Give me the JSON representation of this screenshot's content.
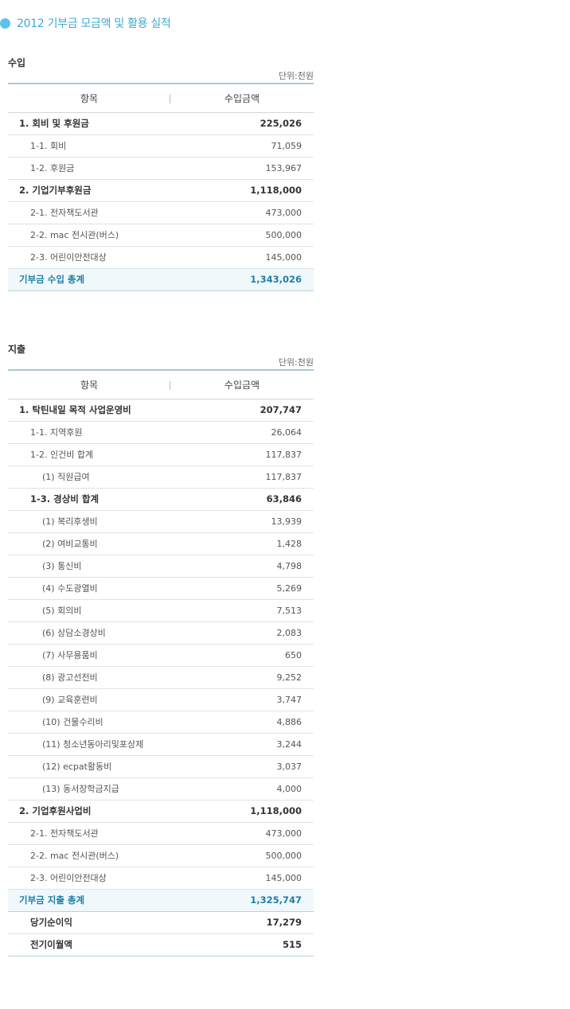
{
  "heading": "2012 기부금 모금액 및 활용 실적",
  "income": {
    "title": "수입",
    "unit": "단위:천원",
    "header": {
      "item": "항목",
      "amount": "수입금액"
    },
    "rows": [
      {
        "level": 1,
        "name": "1. 회비 및 후원금",
        "amount": "225,026"
      },
      {
        "level": 2,
        "name": "1-1. 회비",
        "amount": "71,059"
      },
      {
        "level": 2,
        "name": "1-2. 후원금",
        "amount": "153,967"
      },
      {
        "level": 1,
        "name": "2. 기업기부후원금",
        "amount": "1,118,000"
      },
      {
        "level": 2,
        "name": "2-1. 전자책도서관",
        "amount": "473,000"
      },
      {
        "level": 2,
        "name": "2-2. mac 전시관(버스)",
        "amount": "500,000"
      },
      {
        "level": 2,
        "name": "2-3. 어린이안전대상",
        "amount": "145,000"
      }
    ],
    "total": {
      "name": "기부금 수입 총계",
      "amount": "1,343,026"
    }
  },
  "expense": {
    "title": "지출",
    "unit": "단위:천원",
    "header": {
      "item": "항목",
      "amount": "수입금액"
    },
    "rows": [
      {
        "level": 1,
        "name": "1. 탁틴내일 목적 사업운영비",
        "amount": "207,747"
      },
      {
        "level": 2,
        "name": "1-1. 지역후원",
        "amount": "26,064"
      },
      {
        "level": 2,
        "name": "1-2. 인건비 합계",
        "amount": "117,837"
      },
      {
        "level": 3,
        "name": "(1) 직원급여",
        "amount": "117,837"
      },
      {
        "level": 2,
        "name": "1-3. 경상비 합계",
        "amount": "63,846",
        "bold": true
      },
      {
        "level": 3,
        "name": "(1) 복리후생비",
        "amount": "13,939"
      },
      {
        "level": 3,
        "name": "(2) 여비교통비",
        "amount": "1,428"
      },
      {
        "level": 3,
        "name": "(3) 통신비",
        "amount": "4,798"
      },
      {
        "level": 3,
        "name": "(4) 수도광열비",
        "amount": "5,269"
      },
      {
        "level": 3,
        "name": "(5) 회의비",
        "amount": "7,513"
      },
      {
        "level": 3,
        "name": "(6) 상담소경상비",
        "amount": "2,083"
      },
      {
        "level": 3,
        "name": "(7) 사무용품비",
        "amount": "650"
      },
      {
        "level": 3,
        "name": "(8) 광고선전비",
        "amount": "9,252"
      },
      {
        "level": 3,
        "name": "(9) 교육훈련비",
        "amount": "3,747"
      },
      {
        "level": 3,
        "name": "(10) 건물수리비",
        "amount": "4,886"
      },
      {
        "level": 3,
        "name": "(11) 청소년동아리및포상제",
        "amount": "3,244"
      },
      {
        "level": 3,
        "name": "(12) ecpat활동비",
        "amount": "3,037"
      },
      {
        "level": 3,
        "name": "(13) 동서장학금지급",
        "amount": "4,000"
      },
      {
        "level": 1,
        "name": "2. 기업후원사업비",
        "amount": "1,118,000"
      },
      {
        "level": 2,
        "name": "2-1. 전자책도서관",
        "amount": "473,000"
      },
      {
        "level": 2,
        "name": "2-2. mac 전시관(버스)",
        "amount": "500,000"
      },
      {
        "level": 2,
        "name": "2-3. 어린이안전대상",
        "amount": "145,000"
      }
    ],
    "total": {
      "name": "기부금 지출 총계",
      "amount": "1,325,747"
    },
    "extra": [
      {
        "name": "당기순이익",
        "amount": "17,279"
      },
      {
        "name": "전기이월액",
        "amount": "515"
      }
    ]
  },
  "colors": {
    "accent": "#5bc3e9",
    "heading_text": "#3fa8cf",
    "total_text": "#1f7fa4",
    "total_bg": "#f0f8fc"
  }
}
